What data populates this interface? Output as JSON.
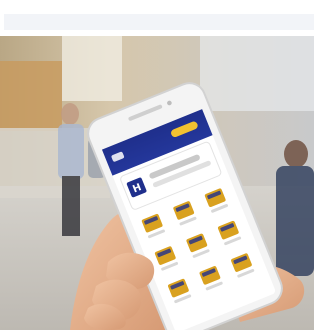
{
  "image": {
    "subject": "hand-holding-smartphone-banking-app",
    "colors": {
      "app_header": "#1f2f8c",
      "app_accent": "#f2c230",
      "app_icon": "#d9a11f",
      "phone_body": "#f4f4f4",
      "background_wall": "#d9c9ad",
      "skin": "#e7b38f"
    }
  },
  "app": {
    "header_label": "",
    "search_label": "",
    "card_title": "",
    "grid_labels": [
      "",
      "",
      "",
      "",
      "",
      "",
      "",
      "",
      ""
    ]
  }
}
